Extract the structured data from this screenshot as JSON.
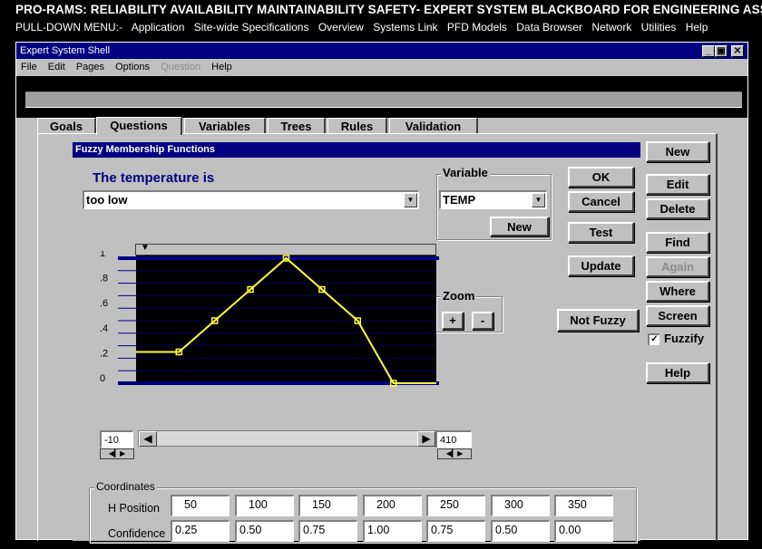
{
  "app": {
    "title": "PRO-RAMS: RELIABILITY AVAILABILITY MAINTAINABILITY SAFETY- EXPERT SYSTEM BLACKBOARD FOR ENGINEERING ASSETS",
    "menu": [
      "PULL-DOWN MENU:-",
      "Application",
      "Site-wide Specifications",
      "Overview",
      "Systems Link",
      "PFD Models",
      "Data Browser",
      "Network",
      "Utilities",
      "Help"
    ]
  },
  "window": {
    "title": "Expert System Shell",
    "menu": [
      {
        "label": "File",
        "enabled": true
      },
      {
        "label": "Edit",
        "enabled": true
      },
      {
        "label": "Pages",
        "enabled": true
      },
      {
        "label": "Options",
        "enabled": true
      },
      {
        "label": "Question",
        "enabled": false
      },
      {
        "label": "Help",
        "enabled": true
      }
    ],
    "controls": [
      "_",
      "▣",
      "✕"
    ]
  },
  "tabs": [
    {
      "label": "Goals",
      "active": false
    },
    {
      "label": "Questions",
      "active": true
    },
    {
      "label": "Variables",
      "active": false
    },
    {
      "label": "Trees",
      "active": false
    },
    {
      "label": "Rules",
      "active": false
    },
    {
      "label": "Validation",
      "active": false
    }
  ],
  "side_buttons": {
    "new": "New",
    "edit": "Edit",
    "delete": "Delete",
    "find": "Find",
    "again": "Again",
    "where": "Where",
    "screen": "Screen",
    "fuzzify": "Fuzzify",
    "fuzzify_checked": "✓",
    "help": "Help"
  },
  "dialog": {
    "title": "Fuzzy Membership Functions",
    "prompt": "The temperature is",
    "term_value": "too low",
    "variable_label": "Variable",
    "variable_value": "TEMP",
    "var_new": "New",
    "ok": "OK",
    "cancel": "Cancel",
    "test": "Test",
    "update": "Update",
    "zoom_label": "Zoom",
    "zoom_in": "+",
    "zoom_out": "-",
    "not_fuzzy": "Not Fuzzy",
    "range_min": "-10",
    "range_max": "410",
    "coordinates_label": "Coordinates",
    "h_position_label": "H Position",
    "confidence_label": "Confidence",
    "h_positions": [
      "50",
      "100",
      "150",
      "200",
      "250",
      "300",
      "350"
    ],
    "confidences": [
      "0.25",
      "0.50",
      "0.75",
      "1.00",
      "0.75",
      "0.50",
      "0.00"
    ]
  },
  "chart_data": {
    "type": "line",
    "x": [
      -10,
      50,
      100,
      150,
      200,
      250,
      300,
      350,
      410
    ],
    "y": [
      0.25,
      0.25,
      0.5,
      0.75,
      1.0,
      0.75,
      0.5,
      0.0,
      0.0
    ],
    "xlim": [
      -10,
      410
    ],
    "ylim": [
      0,
      1
    ],
    "ytick_labels": [
      "1",
      ".8",
      ".6",
      ".4",
      ".2",
      "0"
    ],
    "line_color": "#ffff33",
    "background": "#000000",
    "grid": true
  }
}
